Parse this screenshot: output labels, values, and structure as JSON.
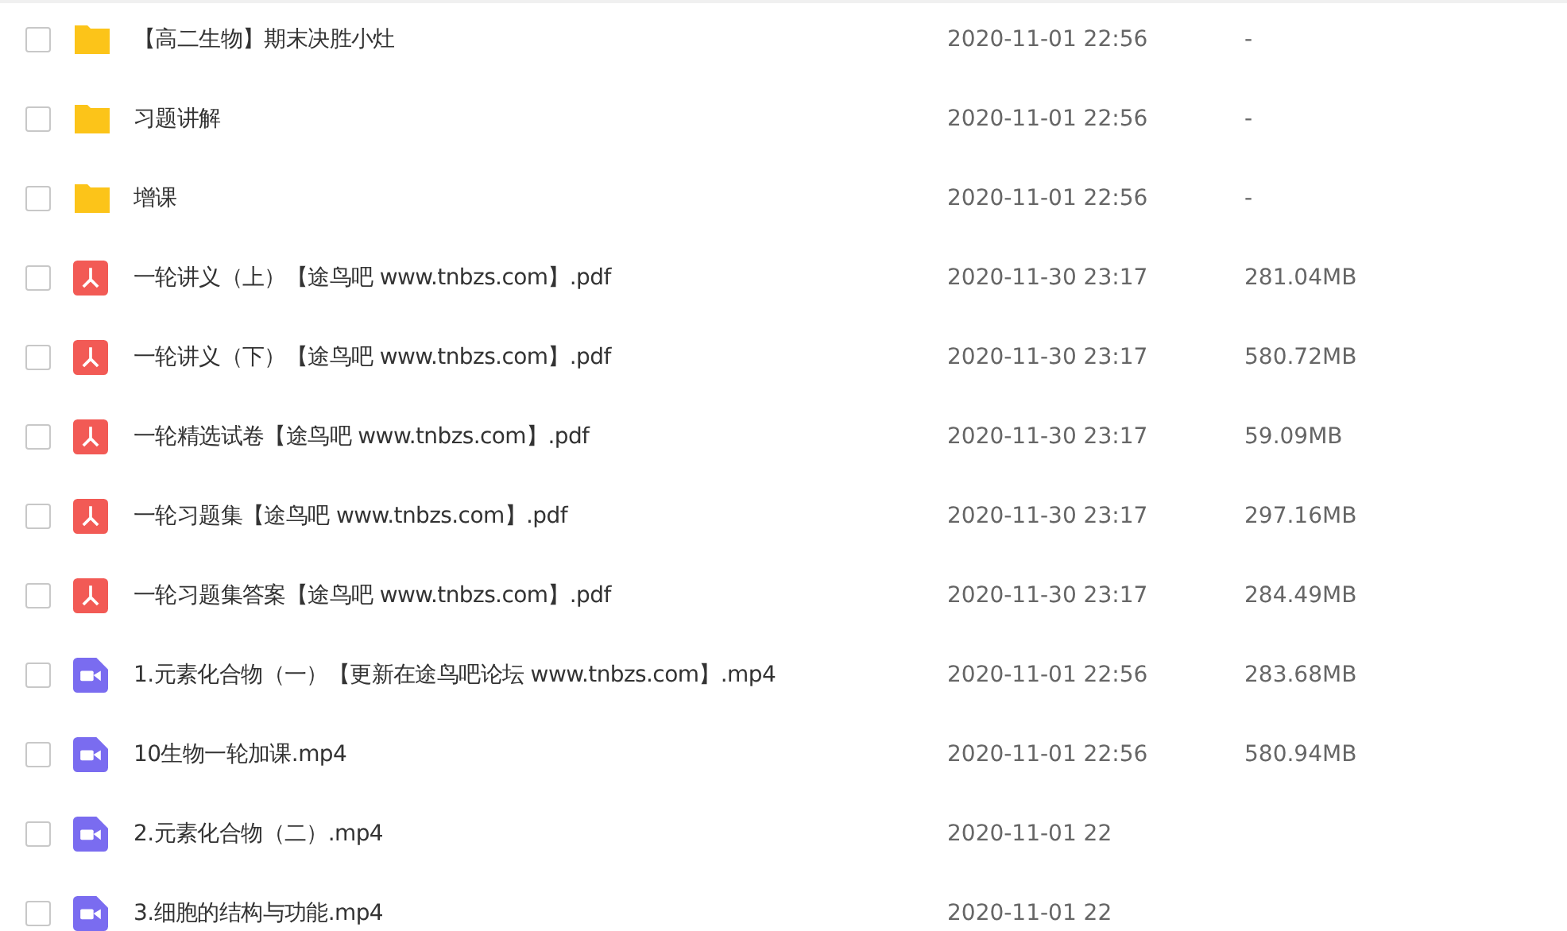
{
  "files": [
    {
      "kind": "folder",
      "name": "【高二生物】期末决胜小灶",
      "date": "2020-11-01 22:56",
      "size": "-",
      "checked": false
    },
    {
      "kind": "folder",
      "name": "习题讲解",
      "date": "2020-11-01 22:56",
      "size": "-",
      "checked": false
    },
    {
      "kind": "folder",
      "name": "增课",
      "date": "2020-11-01 22:56",
      "size": "-",
      "checked": false
    },
    {
      "kind": "pdf",
      "name": "一轮讲义（上）【途鸟吧 www.tnbzs.com】.pdf",
      "date": "2020-11-30 23:17",
      "size": "281.04MB",
      "checked": false
    },
    {
      "kind": "pdf",
      "name": "一轮讲义（下）【途鸟吧 www.tnbzs.com】.pdf",
      "date": "2020-11-30 23:17",
      "size": "580.72MB",
      "checked": false
    },
    {
      "kind": "pdf",
      "name": "一轮精选试卷【途鸟吧 www.tnbzs.com】.pdf",
      "date": "2020-11-30 23:17",
      "size": "59.09MB",
      "checked": false
    },
    {
      "kind": "pdf",
      "name": "一轮习题集【途鸟吧 www.tnbzs.com】.pdf",
      "date": "2020-11-30 23:17",
      "size": "297.16MB",
      "checked": false
    },
    {
      "kind": "pdf",
      "name": "一轮习题集答案【途鸟吧 www.tnbzs.com】.pdf",
      "date": "2020-11-30 23:17",
      "size": "284.49MB",
      "checked": false
    },
    {
      "kind": "video",
      "name": "1.元素化合物（一）【更新在途鸟吧论坛 www.tnbzs.com】.mp4",
      "date": "2020-11-01 22:56",
      "size": "283.68MB",
      "checked": false
    },
    {
      "kind": "video",
      "name": "10生物一轮加课.mp4",
      "date": "2020-11-01 22:56",
      "size": "580.94MB",
      "checked": false
    },
    {
      "kind": "video",
      "name": "2.元素化合物（二）.mp4",
      "date": "2020-11-01 22",
      "checked": false
    },
    {
      "kind": "video",
      "name": "3.细胞的结构与功能.mp4",
      "date": "2020-11-01 22",
      "checked": false
    }
  ]
}
